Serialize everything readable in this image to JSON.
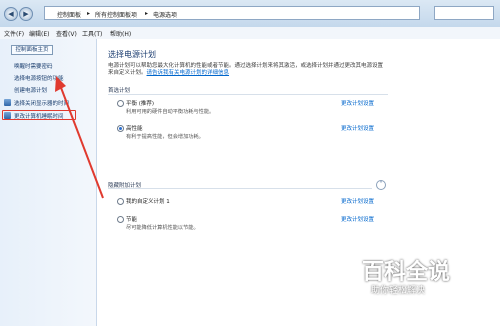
{
  "address_bar": {
    "crumbs": [
      "控制面板",
      "所有控制面板项",
      "电源选项"
    ],
    "separator": "▸"
  },
  "menu": {
    "file": "文件(F)",
    "edit": "编辑(E)",
    "view": "查看(V)",
    "tools": "工具(T)",
    "help": "帮助(H)"
  },
  "sidebar": {
    "home": "控制面板主页",
    "items": [
      "唤醒时需要密码",
      "选择电源按钮的功能",
      "创建电源计划",
      "选择关闭显示器的时间",
      "更改计算机睡眠时间"
    ]
  },
  "main": {
    "title": "选择电源计划",
    "desc_line1": "电源计划可以帮助您最大化计算机的性能或者节能。通过选择计划来将其激活，或选择计划并通过更改其电源设置",
    "desc_line2": "来自定义计划。",
    "desc_link": "请告诉我有关电源计划的详细信息",
    "preferred_header": "首选计划",
    "hidden_header": "隐藏附加计划",
    "plans": [
      {
        "name": "平衡 (推荐)",
        "desc": "利用可用的硬件自动平衡功耗与性能。",
        "link": "更改计划设置",
        "selected": false
      },
      {
        "name": "高性能",
        "desc": "有利于提高性能，但会增加功耗。",
        "link": "更改计划设置",
        "selected": true
      },
      {
        "name": "我的自定义计划 1",
        "desc": "",
        "link": "更改计划设置",
        "selected": false
      },
      {
        "name": "节能",
        "desc": "尽可能降低计算机性能以节能。",
        "link": "更改计划设置",
        "selected": false
      }
    ]
  },
  "watermark": {
    "main": "百科全说",
    "sub": "助你轻松解决"
  },
  "colors": {
    "accent_link": "#0066cc",
    "highlight_red": "#e03a2f"
  }
}
